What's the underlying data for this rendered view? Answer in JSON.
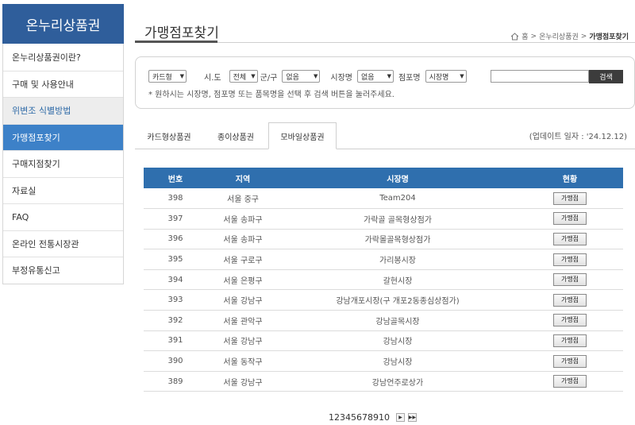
{
  "sidebar": {
    "title": "온누리상품권",
    "items": [
      {
        "label": "온누리상품권이란?"
      },
      {
        "label": "구매 및 사용안내"
      },
      {
        "label": "위변조 식별방법"
      },
      {
        "label": "가맹점포찾기"
      },
      {
        "label": "구매지점찾기"
      },
      {
        "label": "자료실"
      },
      {
        "label": "FAQ"
      },
      {
        "label": "온라인 전통시장관"
      },
      {
        "label": "부정유통신고"
      }
    ]
  },
  "header": {
    "title": "가맹점포찾기",
    "breadcrumb": {
      "home": "홈",
      "sep1": ">",
      "section": "온누리상품권",
      "sep2": ">",
      "current": "가맹점포찾기"
    }
  },
  "search": {
    "type_select": "카드형",
    "sido_label": "시.도",
    "sido_select": "전체",
    "gugun_label": "군/구",
    "gugun_select": "없음",
    "market_label": "시장명",
    "market_select": "없음",
    "store_label": "점포명",
    "store_select": "시장명",
    "input_value": "",
    "button": "검색",
    "note": "* 원하시는 시장명, 점포명 또는 품목명을 선택 후 검색 버튼을 눌러주세요."
  },
  "tabs": [
    {
      "label": "카드형상품권"
    },
    {
      "label": "종이상품권"
    },
    {
      "label": "모바일상품권"
    }
  ],
  "update_text": "(업데이트 일자 : '24.12.12)",
  "table": {
    "headers": {
      "no": "번호",
      "area": "지역",
      "name": "시장명",
      "status": "현황"
    },
    "rows": [
      {
        "no": "398",
        "area": "서울 중구",
        "name": "Team204",
        "btn": "가맹점"
      },
      {
        "no": "397",
        "area": "서울 송파구",
        "name": "가락골 골목형상점가",
        "btn": "가맹점"
      },
      {
        "no": "396",
        "area": "서울 송파구",
        "name": "가락몰골목형상점가",
        "btn": "가맹점"
      },
      {
        "no": "395",
        "area": "서울 구로구",
        "name": "가리봉시장",
        "btn": "가맹점"
      },
      {
        "no": "394",
        "area": "서울 은평구",
        "name": "갈현시장",
        "btn": "가맹점"
      },
      {
        "no": "393",
        "area": "서울 강남구",
        "name": "강남개포시장(구 개포2동종심상점가)",
        "btn": "가맹점"
      },
      {
        "no": "392",
        "area": "서울 관악구",
        "name": "강남골목시장",
        "btn": "가맹점"
      },
      {
        "no": "391",
        "area": "서울 강남구",
        "name": "강남시장",
        "btn": "가맹점"
      },
      {
        "no": "390",
        "area": "서울 동작구",
        "name": "강남시장",
        "btn": "가맹점"
      },
      {
        "no": "389",
        "area": "서울 강남구",
        "name": "강남언주로상가",
        "btn": "가맹점"
      }
    ]
  },
  "pagination": {
    "pages": [
      "1",
      "2",
      "3",
      "4",
      "5",
      "6",
      "7",
      "8",
      "9",
      "10"
    ],
    "next_icon": "next-page-icon",
    "last_icon": "last-page-icon"
  },
  "colors": {
    "primary": "#2f5e9b",
    "active_menu": "#3d81c8",
    "table_header": "#2f6fae"
  }
}
